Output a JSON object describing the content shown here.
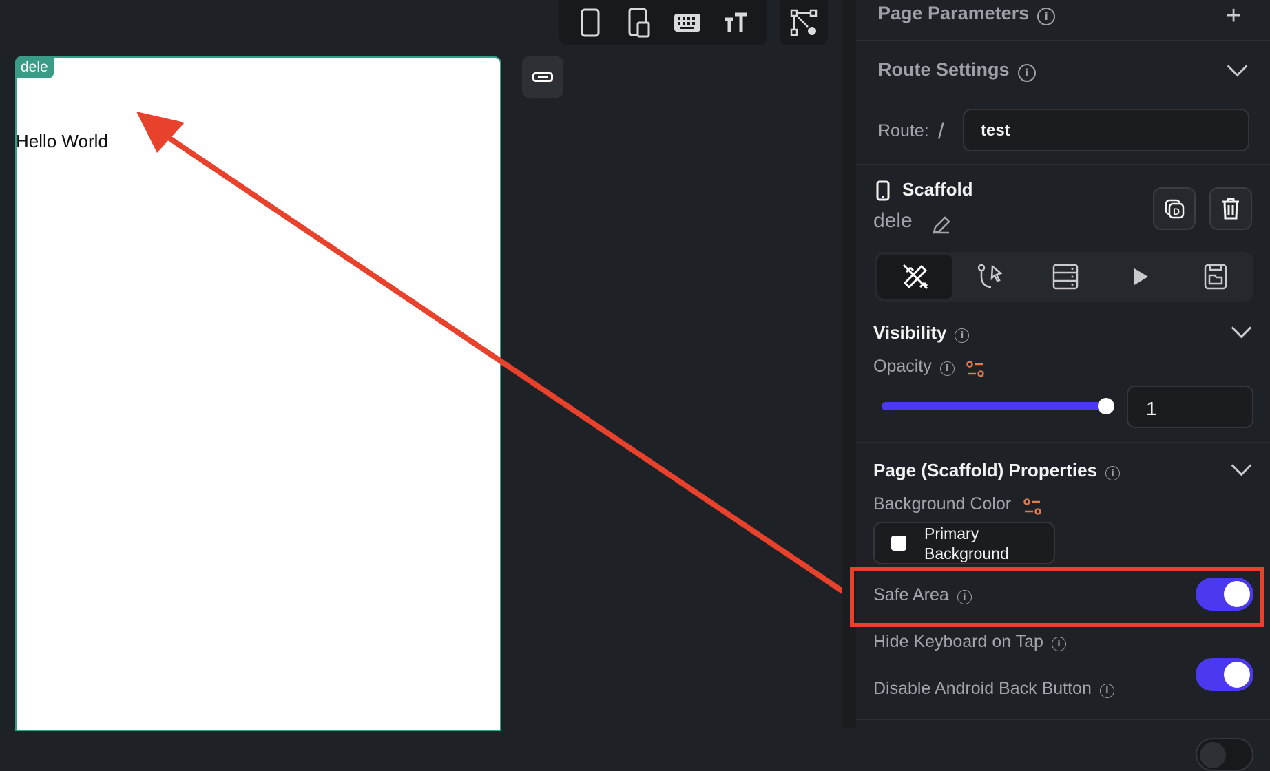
{
  "canvas": {
    "device_tag": "dele",
    "hello_text": "Hello World"
  },
  "panel": {
    "page_parameters": "Page Parameters",
    "route_settings": "Route Settings",
    "route_label": "Route:",
    "route_slash": "/",
    "route_value": "test",
    "widget_type": "Scaffold",
    "widget_name": "dele",
    "visibility": "Visibility",
    "opacity_label": "Opacity",
    "opacity_value": "1",
    "opacity_level": 1.0,
    "page_props": "Page (Scaffold) Properties",
    "bg_color_label": "Background Color",
    "bg_color_value_line1": "Primary",
    "bg_color_value_line2": "Background",
    "safe_area": "Safe Area",
    "safe_area_on": true,
    "hide_keyboard": "Hide Keyboard on Tap",
    "hide_keyboard_on": true,
    "disable_back": "Disable Android Back Button",
    "disable_back_on": false
  },
  "colors": {
    "accent": "#4b39ef",
    "highlight": "#e8412c",
    "teal": "#3a9b86",
    "variable_icon": "#e07b4f"
  },
  "icons": [
    "phone-icon",
    "tablet-icon",
    "keyboard-icon",
    "text-size-icon",
    "flow-icon",
    "info-icon",
    "plus-icon",
    "chevron-down-icon",
    "edit-icon",
    "duplicate-icon",
    "trash-icon",
    "properties-icon",
    "actions-icon",
    "backend-icon",
    "play-icon",
    "folder-icon"
  ]
}
